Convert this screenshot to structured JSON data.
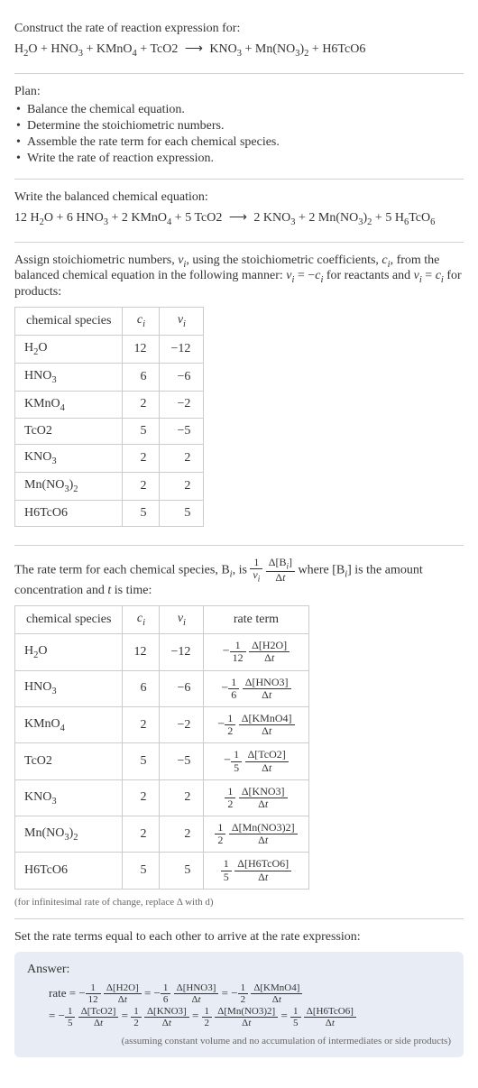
{
  "intro": {
    "prompt": "Construct the rate of reaction expression for:",
    "equation": "H₂O + HNO₃ + KMnO₄ + TcO2 ⟶ KNO₃ + Mn(NO₃)₂ + H6TcO6"
  },
  "plan": {
    "label": "Plan:",
    "items": [
      "Balance the chemical equation.",
      "Determine the stoichiometric numbers.",
      "Assemble the rate term for each chemical species.",
      "Write the rate of reaction expression."
    ]
  },
  "balanced": {
    "label": "Write the balanced chemical equation:",
    "equation": "12 H₂O + 6 HNO₃ + 2 KMnO₄ + 5 TcO2 ⟶ 2 KNO₃ + 2 Mn(NO₃)₂ + 5 H₆TcO₆"
  },
  "stoich_intro": "Assign stoichiometric numbers, νᵢ, using the stoichiometric coefficients, cᵢ, from the balanced chemical equation in the following manner: νᵢ = −cᵢ for reactants and νᵢ = cᵢ for products:",
  "table1": {
    "headers": [
      "chemical species",
      "cᵢ",
      "νᵢ"
    ],
    "rows": [
      {
        "species": "H₂O",
        "c": "12",
        "v": "−12"
      },
      {
        "species": "HNO₃",
        "c": "6",
        "v": "−6"
      },
      {
        "species": "KMnO₄",
        "c": "2",
        "v": "−2"
      },
      {
        "species": "TcO2",
        "c": "5",
        "v": "−5"
      },
      {
        "species": "KNO₃",
        "c": "2",
        "v": "2"
      },
      {
        "species": "Mn(NO₃)₂",
        "c": "2",
        "v": "2"
      },
      {
        "species": "H6TcO6",
        "c": "5",
        "v": "5"
      }
    ]
  },
  "rate_intro_part1": "The rate term for each chemical species, Bᵢ, is ",
  "rate_intro_frac": {
    "num": "1",
    "den": "νᵢ"
  },
  "rate_intro_frac2": {
    "num": "Δ[Bᵢ]",
    "den": "Δt"
  },
  "rate_intro_part2": " where [Bᵢ] is the amount concentration and t is time:",
  "table2": {
    "headers": [
      "chemical species",
      "cᵢ",
      "νᵢ",
      "rate term"
    ],
    "rows": [
      {
        "species": "H₂O",
        "c": "12",
        "v": "−12",
        "sign": "−",
        "coef": {
          "num": "1",
          "den": "12"
        },
        "delta": {
          "num": "Δ[H2O]",
          "den": "Δt"
        }
      },
      {
        "species": "HNO₃",
        "c": "6",
        "v": "−6",
        "sign": "−",
        "coef": {
          "num": "1",
          "den": "6"
        },
        "delta": {
          "num": "Δ[HNO3]",
          "den": "Δt"
        }
      },
      {
        "species": "KMnO₄",
        "c": "2",
        "v": "−2",
        "sign": "−",
        "coef": {
          "num": "1",
          "den": "2"
        },
        "delta": {
          "num": "Δ[KMnO4]",
          "den": "Δt"
        }
      },
      {
        "species": "TcO2",
        "c": "5",
        "v": "−5",
        "sign": "−",
        "coef": {
          "num": "1",
          "den": "5"
        },
        "delta": {
          "num": "Δ[TcO2]",
          "den": "Δt"
        }
      },
      {
        "species": "KNO₃",
        "c": "2",
        "v": "2",
        "sign": "",
        "coef": {
          "num": "1",
          "den": "2"
        },
        "delta": {
          "num": "Δ[KNO3]",
          "den": "Δt"
        }
      },
      {
        "species": "Mn(NO₃)₂",
        "c": "2",
        "v": "2",
        "sign": "",
        "coef": {
          "num": "1",
          "den": "2"
        },
        "delta": {
          "num": "Δ[Mn(NO3)2]",
          "den": "Δt"
        }
      },
      {
        "species": "H6TcO6",
        "c": "5",
        "v": "5",
        "sign": "",
        "coef": {
          "num": "1",
          "den": "5"
        },
        "delta": {
          "num": "Δ[H6TcO6]",
          "den": "Δt"
        }
      }
    ]
  },
  "infinitesimal_note": "(for infinitesimal rate of change, replace Δ with d)",
  "set_equal": "Set the rate terms equal to each other to arrive at the rate expression:",
  "answer": {
    "label": "Answer:",
    "prefix": "rate = ",
    "terms": [
      {
        "sign": "−",
        "coef": {
          "num": "1",
          "den": "12"
        },
        "delta": {
          "num": "Δ[H2O]",
          "den": "Δt"
        }
      },
      {
        "sign": "−",
        "coef": {
          "num": "1",
          "den": "6"
        },
        "delta": {
          "num": "Δ[HNO3]",
          "den": "Δt"
        }
      },
      {
        "sign": "−",
        "coef": {
          "num": "1",
          "den": "2"
        },
        "delta": {
          "num": "Δ[KMnO4]",
          "den": "Δt"
        }
      },
      {
        "sign": "−",
        "coef": {
          "num": "1",
          "den": "5"
        },
        "delta": {
          "num": "Δ[TcO2]",
          "den": "Δt"
        }
      },
      {
        "sign": "",
        "coef": {
          "num": "1",
          "den": "2"
        },
        "delta": {
          "num": "Δ[KNO3]",
          "den": "Δt"
        }
      },
      {
        "sign": "",
        "coef": {
          "num": "1",
          "den": "2"
        },
        "delta": {
          "num": "Δ[Mn(NO3)2]",
          "den": "Δt"
        }
      },
      {
        "sign": "",
        "coef": {
          "num": "1",
          "den": "5"
        },
        "delta": {
          "num": "Δ[H6TcO6]",
          "den": "Δt"
        }
      }
    ],
    "note": "(assuming constant volume and no accumulation of intermediates or side products)"
  }
}
